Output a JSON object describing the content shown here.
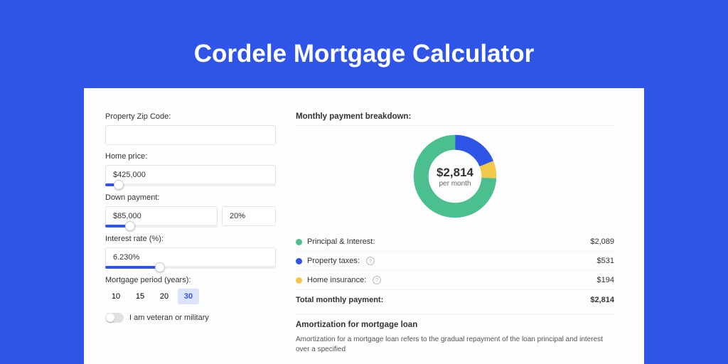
{
  "title": "Cordele Mortgage Calculator",
  "form": {
    "zip_label": "Property Zip Code:",
    "zip_value": "",
    "home_price_label": "Home price:",
    "home_price_value": "$425,000",
    "home_price_slider_pct": 8,
    "down_label": "Down payment:",
    "down_amount": "$85,000",
    "down_pct": "20%",
    "down_slider_pct": 22,
    "rate_label": "Interest rate (%):",
    "rate_value": "6.230%",
    "rate_slider_pct": 32,
    "period_label": "Mortgage period (years):",
    "period_options": [
      "10",
      "15",
      "20",
      "30"
    ],
    "period_active": "30",
    "veteran_label": "I am veteran or military",
    "veteran_on": false
  },
  "breakdown": {
    "heading": "Monthly payment breakdown:",
    "donut_amount": "$2,814",
    "donut_sub": "per month",
    "items": [
      {
        "label": "Principal & Interest:",
        "value": "$2,089",
        "color": "#4bbf8f",
        "pct": 74.2
      },
      {
        "label": "Property taxes:",
        "value": "$531",
        "color": "#2f55e8",
        "pct": 18.9,
        "info": true
      },
      {
        "label": "Home insurance:",
        "value": "$194",
        "color": "#f1c84a",
        "pct": 6.9,
        "info": true
      }
    ],
    "total_label": "Total monthly payment:",
    "total_value": "$2,814"
  },
  "amort": {
    "heading": "Amortization for mortgage loan",
    "text": "Amortization for a mortgage loan refers to the gradual repayment of the loan principal and interest over a specified"
  },
  "chart_data": {
    "type": "pie",
    "title": "Monthly payment breakdown",
    "series": [
      {
        "name": "Principal & Interest",
        "value": 2089,
        "color": "#4bbf8f"
      },
      {
        "name": "Property taxes",
        "value": 531,
        "color": "#2f55e8"
      },
      {
        "name": "Home insurance",
        "value": 194,
        "color": "#f1c84a"
      }
    ],
    "total": 2814
  }
}
